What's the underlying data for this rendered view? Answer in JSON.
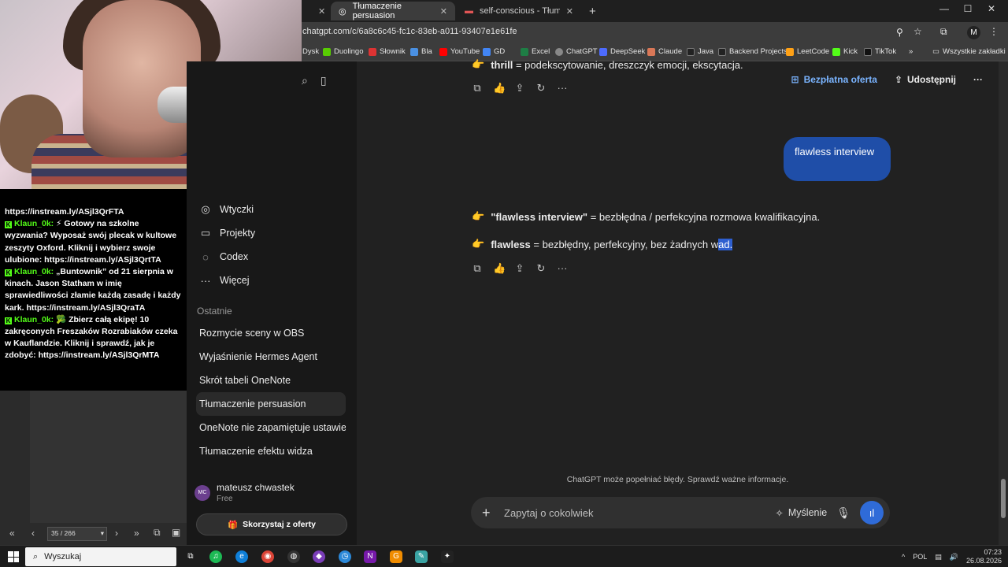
{
  "browser": {
    "tabs": [
      {
        "label": "Tłumaczenie persuasion",
        "active": true
      },
      {
        "label": "self-conscious - Tłumaczenie p",
        "active": false
      }
    ],
    "new_tab": "+",
    "url": "chatgpt.com/c/6a8c6c45-fc1c-83eb-a011-93407e1e61fe",
    "profile_initial": "M",
    "bookmarks": [
      "Dysk",
      "Duolingo",
      "Słownik",
      "Bla",
      "YouTube",
      "GD",
      "Excel",
      "ChatGPT",
      "DeepSeek",
      "Claude",
      "Java",
      "Backend Projects",
      "LeetCode",
      "Kick",
      "TikTok"
    ],
    "bookmarks_more": "»",
    "all_bookmarks": "Wszystkie zakładki"
  },
  "stream_chat": {
    "lines": [
      {
        "text": "https://instream.ly/ASjl3QrFTA"
      },
      {
        "user": "Klaun_0k:",
        "text": " ⚡ Gotowy na szkolne wyzwania? Wyposaż swój plecak w kultowe zeszyty Oxford. Kliknij i wybierz swoje ulubione: https://instream.ly/ASjl3QrtTA"
      },
      {
        "user": "Klaun_0k:",
        "text": " „Buntownik” od 21 sierpnia w kinach. Jason Statham w imię sprawiedliwości złamie każdą zasadę i każdy kark. https://instream.ly/ASjl3QraTA"
      },
      {
        "user": "Klaun_0k:",
        "text": " 🥦 Zbierz całą ekipę! 10 zakręconych Freszaków Rozrabiaków czeka w Kauflandzie. Kliknij i sprawdź, jak je zdobyć: https://instream.ly/ASjl3QrMTA"
      }
    ]
  },
  "pdf_viewer": {
    "page_indicator": "35 / 266"
  },
  "sidebar": {
    "items": [
      {
        "label": "Wtyczki",
        "icon": "plugin-icon"
      },
      {
        "label": "Projekty",
        "icon": "folder-icon"
      },
      {
        "label": "Codex",
        "icon": "codex-icon"
      },
      {
        "label": "Więcej",
        "icon": "more-icon"
      }
    ],
    "recent_heading": "Ostatnie",
    "recent": [
      {
        "label": "Rozmycie sceny w OBS",
        "active": false
      },
      {
        "label": "Wyjaśnienie Hermes Agent",
        "active": false
      },
      {
        "label": "Skrót tabeli OneNote",
        "active": false
      },
      {
        "label": "Tłumaczenie persuasion",
        "active": true
      },
      {
        "label": "OneNote nie zapamiętuje ustawień",
        "active": false
      },
      {
        "label": "Tłumaczenie efektu widza",
        "active": false
      }
    ],
    "user": {
      "initials": "MC",
      "name": "mateusz chwastek",
      "plan": "Free"
    },
    "offer_button": "Skorzystaj z oferty"
  },
  "main": {
    "free_offer": "Bezpłatna oferta",
    "share": "Udostępnij",
    "top_line": {
      "term": "thrill",
      "text": " = podekscytowanie, dreszczyk emocji, ekscytacja."
    },
    "user_message": "flawless interview",
    "answer": [
      {
        "term": "\"flawless interview\"",
        "text": " = bezbłędna / perfekcyjna rozmowa kwalifikacyjna."
      },
      {
        "term": "flawless",
        "text": " = bezbłędny, perfekcyjny, bez żadnych w",
        "highlight": "ad."
      }
    ],
    "disclaimer": "ChatGPT może popełniać błędy. Sprawdź ważne informacje.",
    "composer_placeholder": "Zapytaj o cokolwiek",
    "thinking_label": "Myślenie"
  },
  "taskbar": {
    "search_placeholder": "Wyszukaj",
    "lang": "POL",
    "time": "07:23",
    "date": "26.08.2026"
  }
}
